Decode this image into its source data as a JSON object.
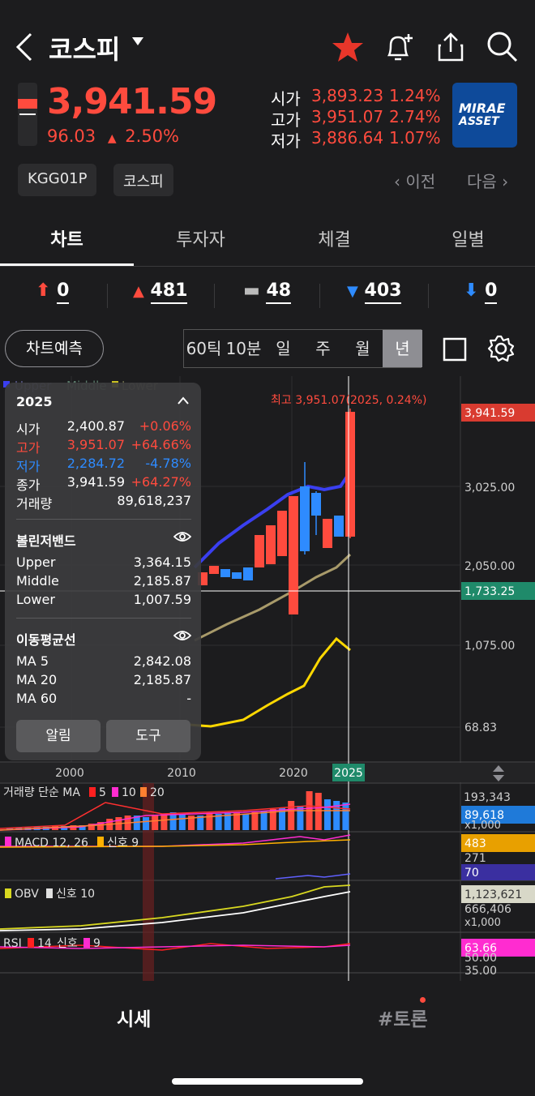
{
  "header": {
    "title": "코스피",
    "price": "3,941.59",
    "change": "96.03",
    "change_pct": "2.50%",
    "open_label": "시가",
    "open": "3,893.23",
    "open_pct": "1.24%",
    "high_label": "고가",
    "high": "3,951.07",
    "high_pct": "2.74%",
    "low_label": "저가",
    "low": "3,886.64",
    "low_pct": "1.07%",
    "logo_line1": "MIRAE",
    "logo_line2": "ASSET",
    "chip1": "KGG01P",
    "chip2": "코스피",
    "prev": "이전",
    "next": "다음"
  },
  "tabs": [
    "차트",
    "투자자",
    "체결",
    "일별"
  ],
  "counts": {
    "upper_limit": "0",
    "up": "481",
    "flat": "48",
    "down": "403",
    "lower_limit": "0"
  },
  "controls": {
    "predict": "차트예측",
    "periods": [
      "60틱",
      "10분",
      "일",
      "주",
      "월",
      "년"
    ]
  },
  "chart": {
    "legend_bb": [
      "Upper",
      "Middle",
      "Lower"
    ],
    "high_note": "최고 3,951.07(2025, 0.24%)",
    "price_tag": "3,941.59",
    "cursor_tag": "1,733.25",
    "y_ticks": [
      "3,025.00",
      "2,050.00",
      "1,075.00",
      "68.83"
    ],
    "x_ticks": [
      "2000",
      "2010",
      "2020"
    ],
    "x_selected": "2025",
    "vol_label": "거래량 단순 MA",
    "vol_ma": [
      "5",
      "10",
      "20"
    ],
    "vol_ticks": [
      "193,343",
      "89,618",
      "x1,000"
    ],
    "macd_label": "MACD 12, 26",
    "macd_signal": "신호 9",
    "macd_ticks": [
      "483",
      "271",
      "70"
    ],
    "obv_label": "OBV",
    "obv_signal": "신호 10",
    "obv_ticks": [
      "1,123,621",
      "666,406",
      "x1,000"
    ],
    "rsi_label": "RSI",
    "rsi_period": "14",
    "rsi_signal": "신호",
    "rsi_signal_period": "9",
    "rsi_ticks": [
      "63.66",
      "50.00",
      "35.00"
    ]
  },
  "info_panel": {
    "year": "2025",
    "rows": [
      {
        "k": "시가",
        "v": "2,400.87",
        "p": "+0.06%"
      },
      {
        "k": "고가",
        "v": "3,951.07",
        "p": "+64.66%"
      },
      {
        "k": "저가",
        "v": "2,284.72",
        "p": "-4.78%"
      },
      {
        "k": "종가",
        "v": "3,941.59",
        "p": "+64.27%"
      }
    ],
    "volume_label": "거래량",
    "volume": "89,618,237",
    "bb_title": "볼린저밴드",
    "bb": [
      {
        "k": "Upper",
        "v": "3,364.15"
      },
      {
        "k": "Middle",
        "v": "2,185.87"
      },
      {
        "k": "Lower",
        "v": "1,007.59"
      }
    ],
    "ma_title": "이동평균선",
    "ma": [
      {
        "k": "MA 5",
        "v": "2,842.08"
      },
      {
        "k": "MA 20",
        "v": "2,185.87"
      },
      {
        "k": "MA 60",
        "v": "-"
      }
    ],
    "alert_btn": "알림",
    "tool_btn": "도구"
  },
  "bottom": {
    "tab1": "시세",
    "tab2": "#토론"
  },
  "colors": {
    "up": "#ff4b3e",
    "down": "#2e8bff",
    "bg": "#1c1c1e",
    "price_tag": "#d93b30",
    "cursor_tag": "#1f8a6a",
    "bb_line": "#3a3ff0",
    "ma20": "#a89a6a",
    "ma5": "#ffd800"
  }
}
